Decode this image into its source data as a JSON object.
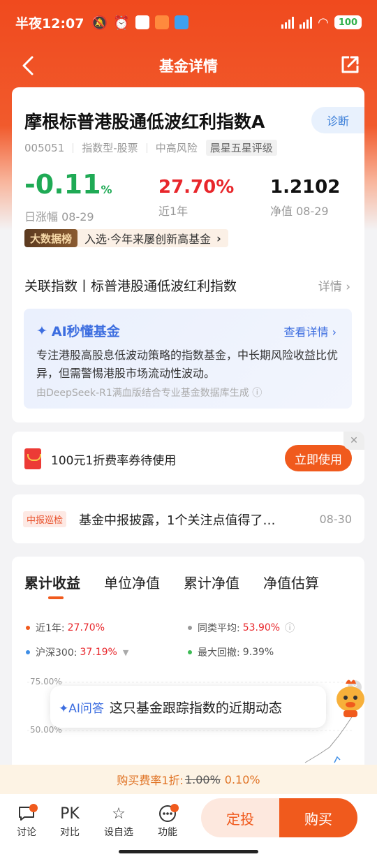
{
  "status_bar": {
    "time": "半夜12:07",
    "battery": "100"
  },
  "nav": {
    "title": "基金详情"
  },
  "fund": {
    "name": "摩根标普港股通低波红利指数A",
    "diagnose_label": "诊断",
    "code": "005051",
    "type": "指数型-股票",
    "risk": "中高风险",
    "rating": "晨星五星评级",
    "daily_change": "-0.11",
    "daily_change_unit": "%",
    "daily_label": "日涨幅 08-29",
    "year_return": "27.70%",
    "year_label": "近1年",
    "nav_value": "1.2102",
    "nav_label": "净值 08-29"
  },
  "bigdata": {
    "tag": "大数据榜",
    "text": "入选·今年来屡创新高基金",
    "arrow": "›"
  },
  "related_index": {
    "label": "关联指数丨标普港股通低波红利指数",
    "detail": "详情 ›"
  },
  "ai_box": {
    "title": "AI秒懂基金",
    "more": "查看详情 ›",
    "text": "专注港股高股息低波动策略的指数基金，中长期风险收益比优异，但需警惕港股市场流动性波动。",
    "source": "由DeepSeek-R1满血版结合专业基金数据库生成 ⓘ"
  },
  "coupon": {
    "text": "100元1折费率券待使用",
    "button": "立即使用",
    "close": "✕"
  },
  "news": {
    "tag": "中报巡检",
    "text": "基金中报披露，1个关注点值得了…",
    "date": "08-30"
  },
  "chart_tabs": [
    "累计收益",
    "单位净值",
    "累计净值",
    "净值估算"
  ],
  "legend": {
    "year_label": "近1年:",
    "year_value": "27.70%",
    "peer_label": "同类平均:",
    "peer_value": "53.90%",
    "hs300_label": "沪深300:",
    "hs300_value": "37.19%",
    "drawdown_label": "最大回撤:",
    "drawdown_value": "9.39%"
  },
  "chart_data": {
    "type": "line",
    "y_ticks": [
      "75.00%",
      "50.00%"
    ]
  },
  "ai_ask": {
    "label": "✦AI问答",
    "text": "这只基金跟踪指数的近期动态",
    "close": "✕"
  },
  "fee": {
    "prefix": "购买费率1折:",
    "old": "1.00%",
    "new": "0.10%"
  },
  "bottom_nav": [
    {
      "label": "讨论",
      "icon": "chat-icon"
    },
    {
      "label": "对比",
      "icon": "pk-icon",
      "glyph": "PK"
    },
    {
      "label": "设自选",
      "icon": "star-icon"
    },
    {
      "label": "功能",
      "icon": "more-icon"
    }
  ],
  "buttons": {
    "dingtou": "定投",
    "buy": "购买"
  },
  "colors": {
    "brand": "#f05a1d",
    "up": "#e8262b",
    "down": "#1faa55",
    "ai_blue": "#3d6ee0"
  }
}
